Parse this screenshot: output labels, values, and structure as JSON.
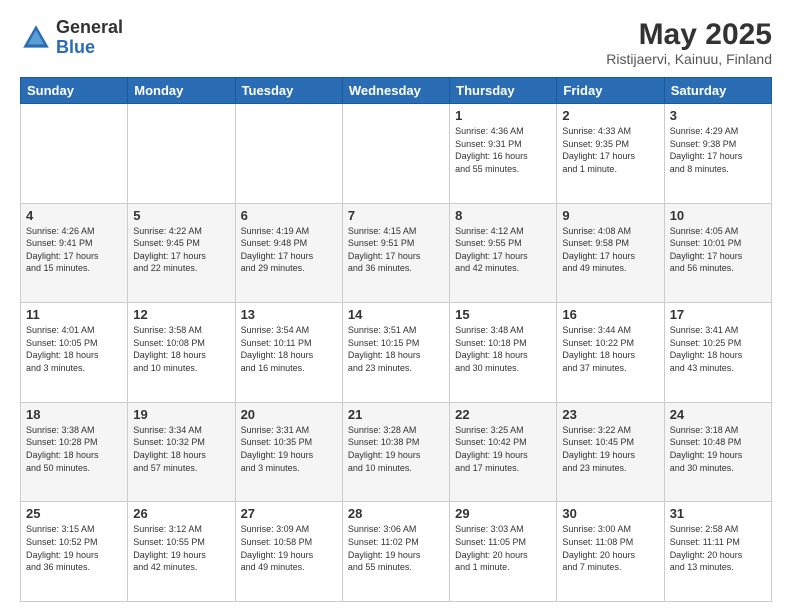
{
  "header": {
    "logo_general": "General",
    "logo_blue": "Blue",
    "month_title": "May 2025",
    "location": "Ristijaervi, Kainuu, Finland"
  },
  "days_of_week": [
    "Sunday",
    "Monday",
    "Tuesday",
    "Wednesday",
    "Thursday",
    "Friday",
    "Saturday"
  ],
  "weeks": [
    [
      {
        "day": "",
        "info": ""
      },
      {
        "day": "",
        "info": ""
      },
      {
        "day": "",
        "info": ""
      },
      {
        "day": "",
        "info": ""
      },
      {
        "day": "1",
        "info": "Sunrise: 4:36 AM\nSunset: 9:31 PM\nDaylight: 16 hours\nand 55 minutes."
      },
      {
        "day": "2",
        "info": "Sunrise: 4:33 AM\nSunset: 9:35 PM\nDaylight: 17 hours\nand 1 minute."
      },
      {
        "day": "3",
        "info": "Sunrise: 4:29 AM\nSunset: 9:38 PM\nDaylight: 17 hours\nand 8 minutes."
      }
    ],
    [
      {
        "day": "4",
        "info": "Sunrise: 4:26 AM\nSunset: 9:41 PM\nDaylight: 17 hours\nand 15 minutes."
      },
      {
        "day": "5",
        "info": "Sunrise: 4:22 AM\nSunset: 9:45 PM\nDaylight: 17 hours\nand 22 minutes."
      },
      {
        "day": "6",
        "info": "Sunrise: 4:19 AM\nSunset: 9:48 PM\nDaylight: 17 hours\nand 29 minutes."
      },
      {
        "day": "7",
        "info": "Sunrise: 4:15 AM\nSunset: 9:51 PM\nDaylight: 17 hours\nand 36 minutes."
      },
      {
        "day": "8",
        "info": "Sunrise: 4:12 AM\nSunset: 9:55 PM\nDaylight: 17 hours\nand 42 minutes."
      },
      {
        "day": "9",
        "info": "Sunrise: 4:08 AM\nSunset: 9:58 PM\nDaylight: 17 hours\nand 49 minutes."
      },
      {
        "day": "10",
        "info": "Sunrise: 4:05 AM\nSunset: 10:01 PM\nDaylight: 17 hours\nand 56 minutes."
      }
    ],
    [
      {
        "day": "11",
        "info": "Sunrise: 4:01 AM\nSunset: 10:05 PM\nDaylight: 18 hours\nand 3 minutes."
      },
      {
        "day": "12",
        "info": "Sunrise: 3:58 AM\nSunset: 10:08 PM\nDaylight: 18 hours\nand 10 minutes."
      },
      {
        "day": "13",
        "info": "Sunrise: 3:54 AM\nSunset: 10:11 PM\nDaylight: 18 hours\nand 16 minutes."
      },
      {
        "day": "14",
        "info": "Sunrise: 3:51 AM\nSunset: 10:15 PM\nDaylight: 18 hours\nand 23 minutes."
      },
      {
        "day": "15",
        "info": "Sunrise: 3:48 AM\nSunset: 10:18 PM\nDaylight: 18 hours\nand 30 minutes."
      },
      {
        "day": "16",
        "info": "Sunrise: 3:44 AM\nSunset: 10:22 PM\nDaylight: 18 hours\nand 37 minutes."
      },
      {
        "day": "17",
        "info": "Sunrise: 3:41 AM\nSunset: 10:25 PM\nDaylight: 18 hours\nand 43 minutes."
      }
    ],
    [
      {
        "day": "18",
        "info": "Sunrise: 3:38 AM\nSunset: 10:28 PM\nDaylight: 18 hours\nand 50 minutes."
      },
      {
        "day": "19",
        "info": "Sunrise: 3:34 AM\nSunset: 10:32 PM\nDaylight: 18 hours\nand 57 minutes."
      },
      {
        "day": "20",
        "info": "Sunrise: 3:31 AM\nSunset: 10:35 PM\nDaylight: 19 hours\nand 3 minutes."
      },
      {
        "day": "21",
        "info": "Sunrise: 3:28 AM\nSunset: 10:38 PM\nDaylight: 19 hours\nand 10 minutes."
      },
      {
        "day": "22",
        "info": "Sunrise: 3:25 AM\nSunset: 10:42 PM\nDaylight: 19 hours\nand 17 minutes."
      },
      {
        "day": "23",
        "info": "Sunrise: 3:22 AM\nSunset: 10:45 PM\nDaylight: 19 hours\nand 23 minutes."
      },
      {
        "day": "24",
        "info": "Sunrise: 3:18 AM\nSunset: 10:48 PM\nDaylight: 19 hours\nand 30 minutes."
      }
    ],
    [
      {
        "day": "25",
        "info": "Sunrise: 3:15 AM\nSunset: 10:52 PM\nDaylight: 19 hours\nand 36 minutes."
      },
      {
        "day": "26",
        "info": "Sunrise: 3:12 AM\nSunset: 10:55 PM\nDaylight: 19 hours\nand 42 minutes."
      },
      {
        "day": "27",
        "info": "Sunrise: 3:09 AM\nSunset: 10:58 PM\nDaylight: 19 hours\nand 49 minutes."
      },
      {
        "day": "28",
        "info": "Sunrise: 3:06 AM\nSunset: 11:02 PM\nDaylight: 19 hours\nand 55 minutes."
      },
      {
        "day": "29",
        "info": "Sunrise: 3:03 AM\nSunset: 11:05 PM\nDaylight: 20 hours\nand 1 minute."
      },
      {
        "day": "30",
        "info": "Sunrise: 3:00 AM\nSunset: 11:08 PM\nDaylight: 20 hours\nand 7 minutes."
      },
      {
        "day": "31",
        "info": "Sunrise: 2:58 AM\nSunset: 11:11 PM\nDaylight: 20 hours\nand 13 minutes."
      }
    ]
  ]
}
